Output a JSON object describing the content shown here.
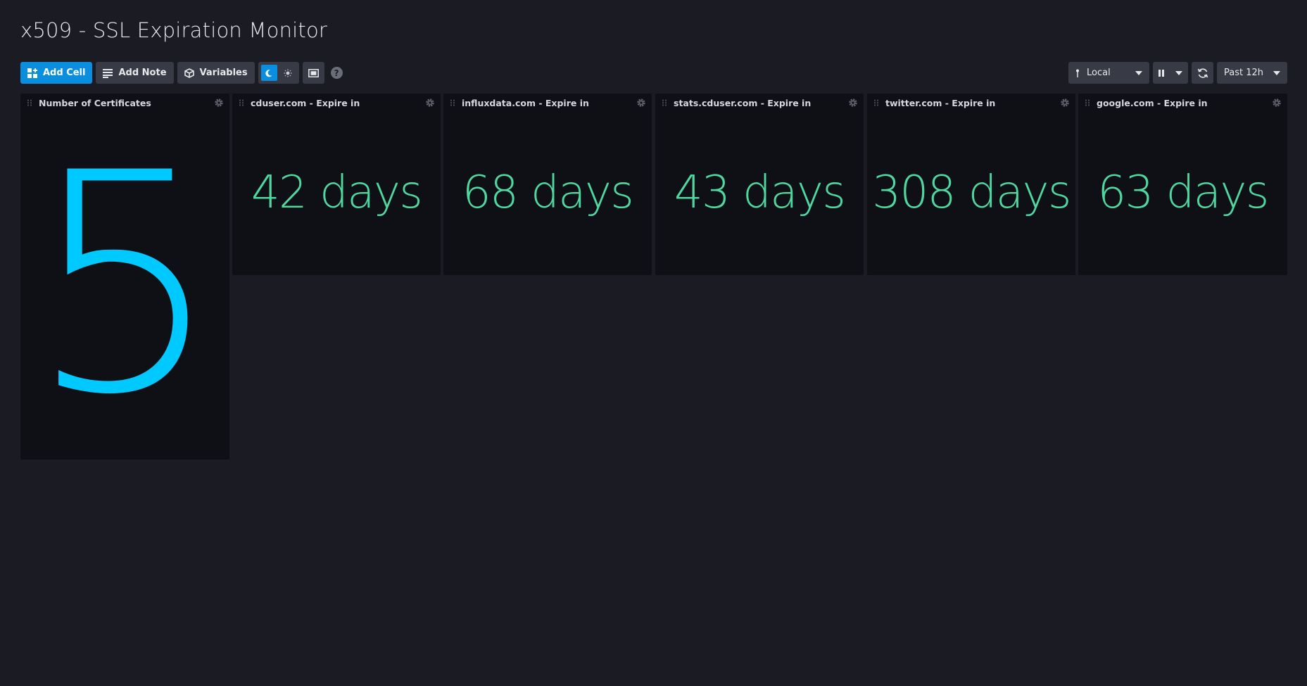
{
  "dashboard": {
    "title": "x509 - SSL Expiration Monitor"
  },
  "toolbar": {
    "add_cell_label": "Add Cell",
    "add_note_label": "Add Note",
    "variables_label": "Variables",
    "timezone_label": "Local",
    "time_range_label": "Past 12h",
    "help_label": "?"
  },
  "cells": [
    {
      "title": "Number of Certificates",
      "value": "5"
    },
    {
      "title": "cduser.com - Expire in",
      "value": "42 days"
    },
    {
      "title": "influxdata.com - Expire in",
      "value": "68 days"
    },
    {
      "title": "stats.cduser.com - Expire in",
      "value": "43 days"
    },
    {
      "title": "twitter.com - Expire in",
      "value": "308 days"
    },
    {
      "title": "google.com - Expire in",
      "value": "63 days"
    }
  ],
  "colors": {
    "primary": "#0a8fe0",
    "single_stat_blue": "#00c9ff",
    "single_stat_green": "#4ed8a0",
    "background": "#1b1c23",
    "cell_background": "#0f0f16"
  },
  "icons": {
    "add_cell": "add-cell-icon",
    "add_note": "note-icon",
    "variables": "cube-icon",
    "dark_mode": "moon-icon",
    "light_mode": "sun-icon",
    "presentation": "fullscreen-icon",
    "help": "help-icon",
    "timezone": "pin-icon",
    "pause": "pause-icon",
    "refresh": "refresh-icon",
    "settings": "gear-icon"
  }
}
